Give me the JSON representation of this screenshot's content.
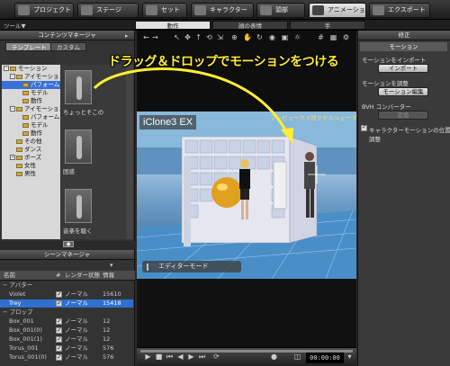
{
  "top_tabs": [
    {
      "label": "プロジェクト",
      "icon": "project-icon",
      "active": false
    },
    {
      "label": "ステージ",
      "icon": "stage-icon",
      "active": false
    },
    {
      "label": "セット",
      "icon": "set-icon",
      "active": false
    },
    {
      "label": "キャラクター",
      "icon": "character-icon",
      "active": false
    },
    {
      "label": "頭部",
      "icon": "head-icon",
      "active": false
    },
    {
      "label": "アニメーション",
      "icon": "animation-icon",
      "active": true
    },
    {
      "label": "エクスポート",
      "icon": "export-icon",
      "active": false
    }
  ],
  "sub_tabs": [
    {
      "label": "動作",
      "active": true
    },
    {
      "label": "顔の表情",
      "active": false
    },
    {
      "label": "手",
      "active": false
    }
  ],
  "tool_dropdown": "ツール▼",
  "content_manager": {
    "title": "コンテンツマネージャ",
    "tabs": [
      {
        "label": "テンプレート",
        "active": true
      },
      {
        "label": "カスタム",
        "active": false
      }
    ],
    "tree": [
      {
        "label": "モーション",
        "depth": 0,
        "toggle": "−",
        "selected": false
      },
      {
        "label": "アイモーション",
        "depth": 1,
        "toggle": "−",
        "selected": false
      },
      {
        "label": "パフォーム",
        "depth": 2,
        "toggle": "",
        "selected": true
      },
      {
        "label": "モデル",
        "depth": 2,
        "toggle": "",
        "selected": false
      },
      {
        "label": "動作",
        "depth": 2,
        "toggle": "",
        "selected": false
      },
      {
        "label": "アイモーション",
        "depth": 1,
        "toggle": "−",
        "selected": false
      },
      {
        "label": "パフォーム",
        "depth": 2,
        "toggle": "",
        "selected": false
      },
      {
        "label": "モデル",
        "depth": 2,
        "toggle": "",
        "selected": false
      },
      {
        "label": "動作",
        "depth": 2,
        "toggle": "",
        "selected": false
      },
      {
        "label": "その他",
        "depth": 1,
        "toggle": "",
        "selected": false
      },
      {
        "label": "ダンス",
        "depth": 1,
        "toggle": "",
        "selected": false
      },
      {
        "label": "ポーズ",
        "depth": 1,
        "toggle": "+",
        "selected": false
      },
      {
        "label": "女性",
        "depth": 1,
        "toggle": "",
        "selected": false
      },
      {
        "label": "男性",
        "depth": 1,
        "toggle": "",
        "selected": false
      }
    ],
    "thumbnails": [
      {
        "label": "ちょっとそこの"
      },
      {
        "label": "困惑"
      },
      {
        "label": "音楽を聴く"
      }
    ]
  },
  "scene_manager": {
    "title": "シーンマネージャ",
    "headers": {
      "name": "名前",
      "hash": "#",
      "render_state": "レンダー状態",
      "info": "情報"
    },
    "rows": [
      {
        "name": "アバター",
        "checked": false,
        "render": "",
        "info": "",
        "indent": 0,
        "selected": false
      },
      {
        "name": "Violet",
        "checked": true,
        "render": "ノーマル",
        "info": "15610",
        "indent": 1,
        "selected": false
      },
      {
        "name": "Trey",
        "checked": true,
        "render": "ノーマル",
        "info": "15418",
        "indent": 1,
        "selected": true
      },
      {
        "name": "プロップ",
        "checked": false,
        "render": "",
        "info": "",
        "indent": 0,
        "selected": false
      },
      {
        "name": "Box_001",
        "checked": true,
        "render": "ノーマル",
        "info": "12",
        "indent": 1,
        "selected": false
      },
      {
        "name": "Box_001(0)",
        "checked": true,
        "render": "ノーマル",
        "info": "12",
        "indent": 1,
        "selected": false
      },
      {
        "name": "Box_001(1)",
        "checked": true,
        "render": "ノーマル",
        "info": "12",
        "indent": 1,
        "selected": false
      },
      {
        "name": "Torus_001",
        "checked": true,
        "render": "ノーマル",
        "info": "576",
        "indent": 1,
        "selected": false
      },
      {
        "name": "Torus_001(0)",
        "checked": true,
        "render": "ノーマル",
        "info": "576",
        "indent": 1,
        "selected": false
      }
    ]
  },
  "viewport": {
    "label": "iClone3 EX",
    "camera_menu": "プレビューカメラ",
    "pixel_menu": "ピクセルシェーダ",
    "editor_mode": "エディターモード"
  },
  "timeline": {
    "time": "00:00:00"
  },
  "modify_panel": {
    "title": "修正",
    "section": "モーション",
    "import_label": "モーションをインポート",
    "import_button": "インポート",
    "adjust_label": "モーションを調整",
    "edit_button": "モーション編集",
    "bvh_label": "BVH コンバーター",
    "bvh_button": "変換",
    "checkbox_label": "キャラクターモーションの位置調整",
    "checkbox_checked": true
  },
  "annotation": "ドラッグ＆ドロップでモーションをつける",
  "colors": {
    "accent": "#ffee33",
    "selection": "#2f6fd0"
  }
}
